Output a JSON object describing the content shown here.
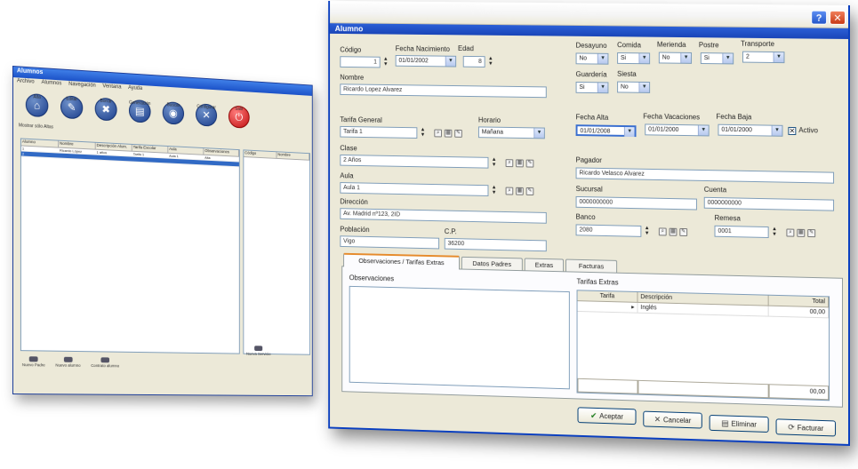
{
  "background_app": {
    "title": "Alumnos",
    "menu": [
      "Archivo",
      "Alumnos",
      "Navegación",
      "Ventana",
      "Ayuda"
    ],
    "toolbar": [
      {
        "label": "Alta",
        "icon": "home-icon"
      },
      {
        "label": "Editar",
        "icon": "edit-icon"
      },
      {
        "label": "Borrar",
        "icon": "delete-icon"
      },
      {
        "label": "Generación",
        "icon": "print-icon"
      },
      {
        "label": "Buscar",
        "icon": "search-icon"
      },
      {
        "label": "Configurar",
        "icon": "settings-icon"
      },
      {
        "label": "Salir",
        "icon": "exit-icon"
      }
    ],
    "filter_label": "Mostrar sólo Altas",
    "grid_headers": [
      "Alumno",
      "Nombre",
      "Descripción Alum.",
      "Tarifa Escolar",
      "Aula",
      "Observaciones"
    ],
    "grid_rows": [
      [
        "1",
        "Ricardo López",
        "1 años",
        "Tarifa 1",
        "Aula 1",
        "Alta"
      ],
      [
        "2",
        "",
        "",
        "",
        "",
        ""
      ]
    ],
    "grid2_headers": [
      "Código",
      "Nombre"
    ],
    "bottom_buttons": [
      "Nuevo Padre",
      "Nuevo alumno",
      "Contrato alumno"
    ],
    "bottom_buttons2": [
      "Nueva Servicio"
    ]
  },
  "dialog": {
    "title": "Alumno",
    "left": {
      "codigo_label": "Código",
      "codigo_value": "1",
      "fecha_nac_label": "Fecha Nacimiento",
      "fecha_nac_value": "01/01/2002",
      "edad_label": "Edad",
      "edad_value": "8",
      "nombre_label": "Nombre",
      "nombre_value": "Ricardo Lopez Alvarez",
      "tarifa_label": "Tarifa General",
      "tarifa_value": "Tarifa 1",
      "horario_label": "Horario",
      "horario_value": "Mañana",
      "clase_label": "Clase",
      "clase_value": "2 Años",
      "aula_label": "Aula",
      "aula_value": "Aula 1",
      "direccion_label": "Dirección",
      "direccion_value": "Av. Madrid nº123, 2ID",
      "poblacion_label": "Población",
      "poblacion_value": "Vigo",
      "cp_label": "C.P.",
      "cp_value": "36200"
    },
    "right": {
      "desayuno_label": "Desayuno",
      "desayuno_value": "No",
      "comida_label": "Comida",
      "comida_value": "Si",
      "merienda_label": "Merienda",
      "merienda_value": "No",
      "postre_label": "Postre",
      "postre_value": "Si",
      "transporte_label": "Transporte",
      "transporte_value": "2",
      "guarderia_label": "Guardería",
      "guarderia_value": "Si",
      "siesta_label": "Siesta",
      "siesta_value": "No",
      "fecha_alta_label": "Fecha Alta",
      "fecha_alta_value": "01/01/2008",
      "fecha_vac_label": "Fecha Vacaciones",
      "fecha_vac_value": "01/01/2000",
      "fecha_baja_label": "Fecha Baja",
      "fecha_baja_value": "01/01/2000",
      "activo_label": "Activo",
      "activo_mark": "✕",
      "pagador_label": "Pagador",
      "pagador_value": "Ricardo Velasco Alvarez",
      "sucursal_label": "Sucursal",
      "sucursal_value": "0000000000",
      "cuenta_label": "Cuenta",
      "cuenta_value": "0000000000",
      "banco_label": "Banco",
      "banco_value": "2080",
      "remesa_label": "Remesa",
      "remesa_value": "0001"
    },
    "tabs": [
      "Observaciones / Tarifas Extras",
      "Datos Padres",
      "Extras",
      "Facturas"
    ],
    "observaciones_label": "Observaciones",
    "tarifas_label": "Tarifas Extras",
    "tarifas_table": {
      "headers": [
        "Tarifa",
        "Descripción",
        "Total"
      ],
      "rows": [
        [
          "",
          "Inglés",
          "00,00"
        ]
      ],
      "footer_total": "00,00"
    },
    "buttons": {
      "aceptar": "Aceptar",
      "cancelar": "Cancelar",
      "eliminar": "Eliminar",
      "facturar": "Facturar"
    }
  }
}
